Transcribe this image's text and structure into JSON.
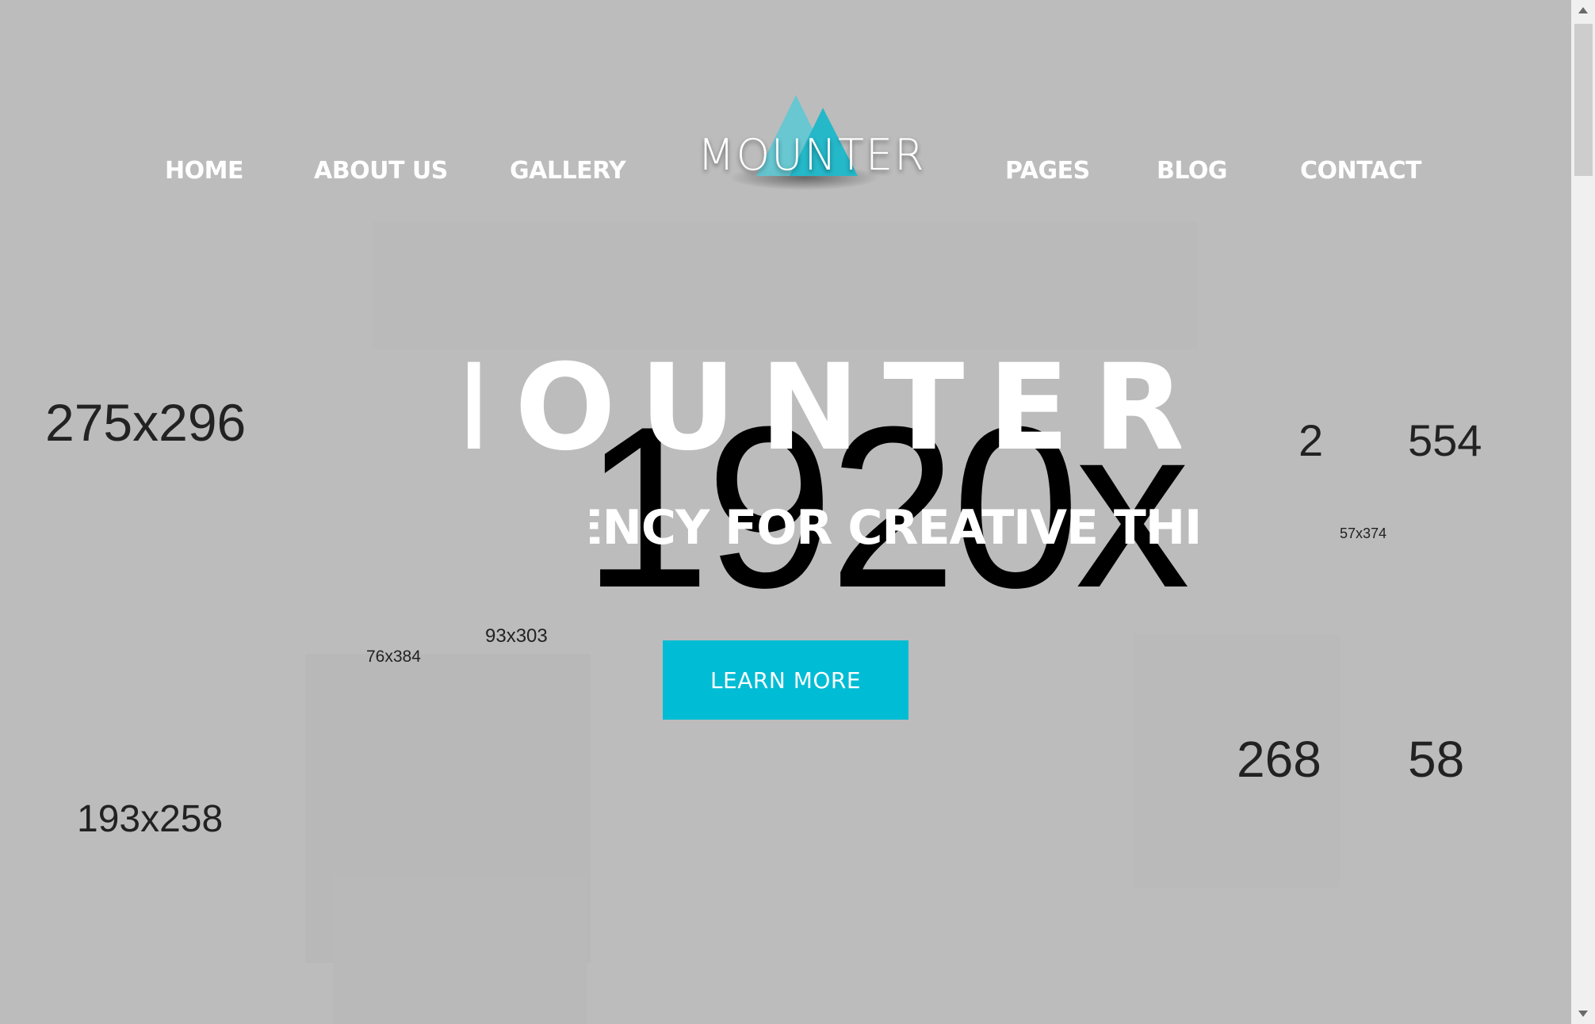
{
  "nav": {
    "home": "HOME",
    "about": "ABOUT US",
    "gallery": "GALLERY",
    "pages": "PAGES",
    "blog": "BLOG",
    "contact": "CONTACT"
  },
  "logo": {
    "text": "MOUNTER",
    "accent_color": "#4fc3d1"
  },
  "hero": {
    "title": "MOUNTER",
    "subtitle": "AGENCY FOR CREATIVE THINKING",
    "cta_label": "LEARN MORE",
    "cta_color": "#00bcd4",
    "background_placeholder": "1920x"
  },
  "placeholders": {
    "p1": "275x296",
    "p2": "193x258",
    "p3": "76x384",
    "p4": "93x303",
    "p5a": "2",
    "p5b": "554",
    "p6": "57x374",
    "p7a": "268",
    "p7b": "58"
  }
}
